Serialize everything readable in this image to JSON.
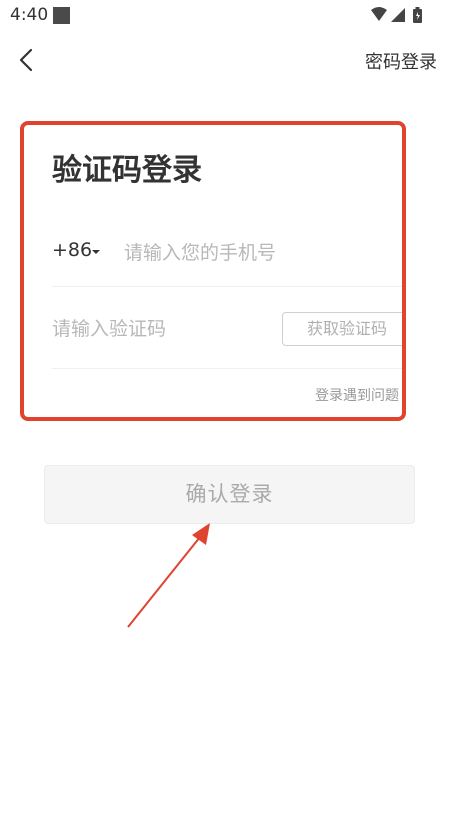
{
  "status_bar": {
    "time": "4:40"
  },
  "nav": {
    "right_link": "密码登录"
  },
  "login": {
    "title": "验证码登录",
    "country_code": "+86",
    "phone_placeholder": "请输入您的手机号",
    "code_placeholder": "请输入验证码",
    "get_code_label": "获取验证码",
    "help_link": "登录遇到问题"
  },
  "confirm_label": "确认登录",
  "colors": {
    "highlight": "#e0442f",
    "disabled_text": "#aaaaaa",
    "placeholder": "#b8b8b8"
  },
  "icons": [
    "back-arrow-icon",
    "wifi-icon",
    "signal-icon",
    "battery-icon",
    "dropdown-caret-icon"
  ]
}
